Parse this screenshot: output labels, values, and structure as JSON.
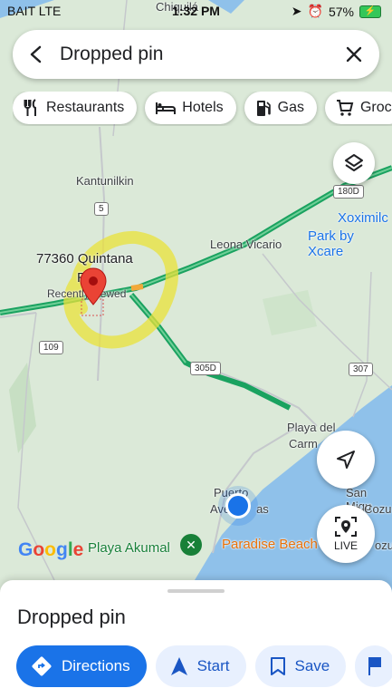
{
  "status_bar": {
    "carrier": "BAIT  LTE",
    "time": "1:32 PM",
    "battery": "57%"
  },
  "search": {
    "query": "Dropped pin"
  },
  "chips": [
    {
      "label": "Restaurants",
      "icon": "fork-knife-icon"
    },
    {
      "label": "Hotels",
      "icon": "bed-icon"
    },
    {
      "label": "Gas",
      "icon": "gas-pump-icon"
    },
    {
      "label": "Groc",
      "icon": "cart-icon"
    }
  ],
  "map": {
    "labels": {
      "chiquila": "Chiquilá",
      "kantunilkin": "Kantunilkin",
      "postal": "77360 Quintana",
      "postal2": "R",
      "recently_viewed": "Recently viewed",
      "leona_vicario": "Leona Vicario",
      "xoximilco": "Xoximilc",
      "xcaret": "Park by Xcare",
      "playa": "Playa del",
      "carmen": "Carm",
      "puerto": "Puerto",
      "aventuras": "Aven      as",
      "san_miguel": "San Migu",
      "cozumel": "de Cozu",
      "playa_akumal": "Playa Akumal",
      "paradise_beach": "Paradise Beach",
      "cozu": "ozu"
    },
    "shields": {
      "r5": "5",
      "r109": "109",
      "r180d": "180D",
      "r305d": "305D",
      "r307": "307"
    },
    "google": "Google",
    "live_label": "LIVE",
    "colors": {
      "water": "#8fc1ea",
      "land": "#dbe9d8",
      "traffic": "#1aa260",
      "pin": "#ea4335"
    }
  },
  "sheet": {
    "title": "Dropped pin",
    "actions": [
      {
        "label": "Directions",
        "icon": "directions-icon"
      },
      {
        "label": "Start",
        "icon": "navigation-arrow-icon"
      },
      {
        "label": "Save",
        "icon": "bookmark-icon"
      }
    ]
  }
}
